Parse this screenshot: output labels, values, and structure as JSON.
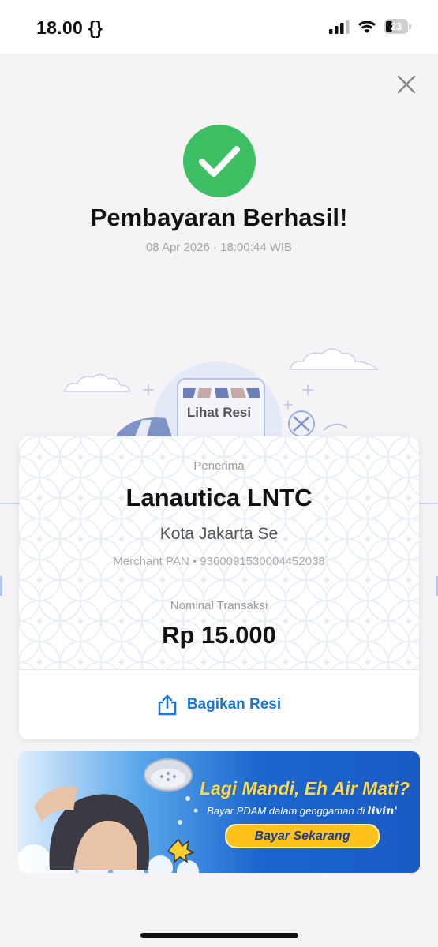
{
  "status_bar": {
    "time": "18.00",
    "time_suffix": "{}",
    "battery_level": "23"
  },
  "success": {
    "title": "Pembayaran Berhasil!",
    "datetime": "08 Apr 2026 · 18:00:44 WIB",
    "check_color": "#3dbf63"
  },
  "lihat_resi_label": "Lihat Resi",
  "receipt": {
    "recipient_label": "Penerima",
    "recipient_name": "Lanautica LNTC",
    "recipient_city": "Kota Jakarta Se",
    "merchant_pan": "Merchant PAN • 9360091530004452038",
    "amount_label": "Nominal Transaksi",
    "amount": "Rp 15.000",
    "share_label": "Bagikan Resi"
  },
  "banner": {
    "title": "Lagi Mandi, Eh Air Mati?",
    "subtitle": "Bayar PDAM dalam genggaman di",
    "brand": "livin'",
    "cta": "Bayar Sekarang"
  },
  "colors": {
    "accent_blue": "#1b74d6",
    "success_green": "#3dbf63",
    "banner_yellow": "#ffd84a"
  },
  "icons": [
    "signal-icon",
    "wifi-icon",
    "battery-icon",
    "close-icon",
    "check-icon",
    "share-icon"
  ]
}
